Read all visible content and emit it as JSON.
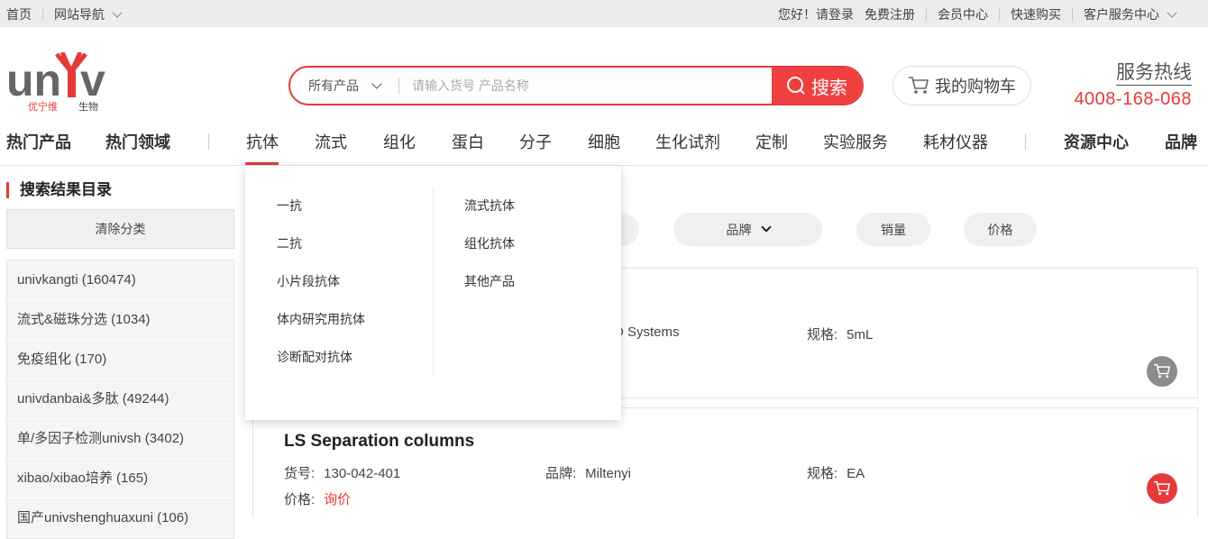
{
  "topbar": {
    "home": "首页",
    "site_nav": "网站导航",
    "greeting": "您好！请登录",
    "register": "免费注册",
    "member": "会员中心",
    "quick_buy": "快速购买",
    "service": "客户服务中心"
  },
  "logo": {
    "text": "univ",
    "sub": "优宁维 生物"
  },
  "search": {
    "category": "所有产品",
    "placeholder": "请输入货号 产品名称",
    "button": "搜索"
  },
  "cart": {
    "label": "我的购物车"
  },
  "hotline": {
    "title": "服务热线",
    "number": "4008-168-068"
  },
  "nav": {
    "hot_products": "热门产品",
    "hot_fields": "热门领域",
    "items": [
      "抗体",
      "流式",
      "组化",
      "蛋白",
      "分子",
      "细胞",
      "生化试剂",
      "定制",
      "实验服务",
      "耗材仪器"
    ],
    "resource": "资源中心",
    "brand": "品牌"
  },
  "sidebar": {
    "title": "搜索结果目录",
    "clear": "清除分类",
    "items": [
      "univkangti (160474)",
      "流式&磁珠分选 (1034)",
      "免疫组化 (170)",
      "univdanbai&多肽 (49244)",
      "单/多因子检测univsh (3402)",
      "xibao/xibao培养 (165)",
      "国产univshenghuaxuni (106)"
    ]
  },
  "sort": {
    "brand": "品牌",
    "sales": "销量",
    "price": "价格"
  },
  "products": [
    {
      "name": "",
      "brand_fragment": "D Systems",
      "spec_label": "规格:",
      "spec": "5mL"
    },
    {
      "name": "LS Separation columns",
      "sku_label": "货号:",
      "sku": "130-042-401",
      "brand_label": "品牌:",
      "brand": "Miltenyi",
      "spec_label": "规格:",
      "spec": "EA",
      "price_label": "价格:",
      "price": "询价"
    }
  ],
  "dropdown": {
    "left": [
      "一抗",
      "二抗",
      "小片段抗体",
      "体内研究用抗体",
      "诊断配对抗体"
    ],
    "right": [
      "流式抗体",
      "组化抗体",
      "其他产品"
    ]
  },
  "colors": {
    "accent": "#e63a3a",
    "cart_gray": "#8c8c8c"
  }
}
